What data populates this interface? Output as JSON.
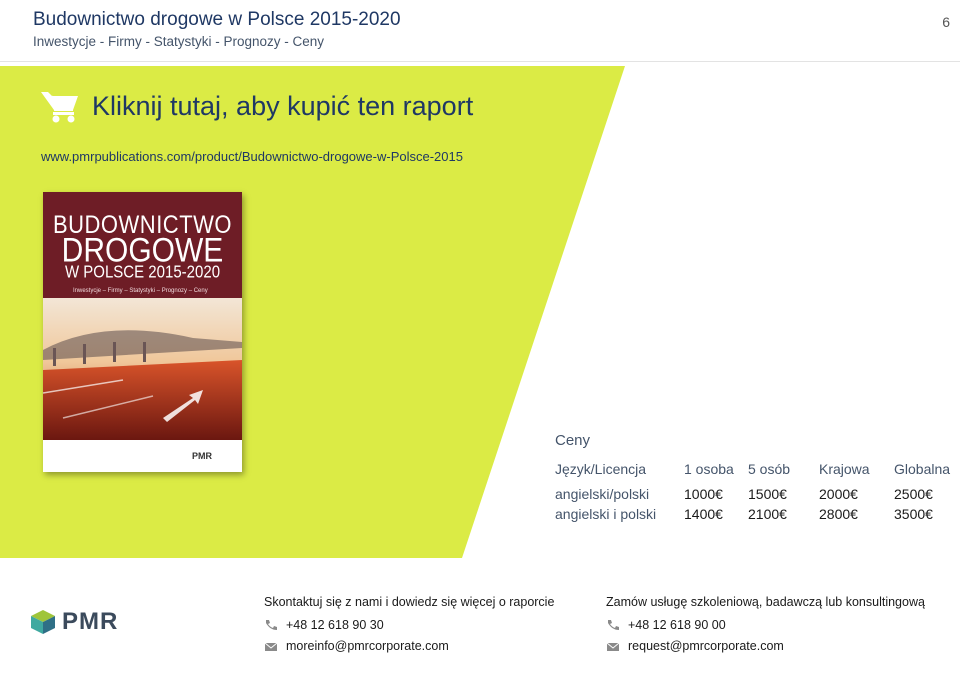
{
  "header": {
    "title": "Budownictwo drogowe w Polsce 2015-2020",
    "subtitle": "Inwestycje - Firmy - Statystyki - Prognozy - Ceny",
    "page_number": "6"
  },
  "promo": {
    "buy_label": "Kliknij tutaj, aby kupić ten raport",
    "url": "www.pmrpublications.com/product/Budownictwo-drogowe-w-Polsce-2015",
    "accent_color": "#dbeb45",
    "icon": "shopping-cart-icon"
  },
  "cover": {
    "line1": "BUDOWNICTWO",
    "line2": "DROGOWE",
    "line3": "W POLSCE 2015-2020",
    "line4": "Inwestycje – Firmy – Statystyki – Prognozy – Ceny",
    "logo": "PMR"
  },
  "prices": {
    "title": "Ceny",
    "headers": [
      "Język/Licencja",
      "1 osoba",
      "5 osób",
      "Krajowa",
      "Globalna"
    ],
    "rows": [
      {
        "lang": "angielski/polski",
        "p1": "1000€",
        "p5": "1500€",
        "national": "2000€",
        "global": "2500€"
      },
      {
        "lang": "angielski i polski",
        "p1": "1400€",
        "p5": "2100€",
        "national": "2800€",
        "global": "3500€"
      }
    ]
  },
  "footer": {
    "logo_text": "PMR",
    "left": {
      "heading": "Skontaktuj się z nami i dowiedz się więcej o raporcie",
      "phone": "+48 12 618 90 30",
      "email": "moreinfo@pmrcorporate.com"
    },
    "right": {
      "heading": "Zamów usługę szkoleniową, badawczą lub konsultingową",
      "phone": "+48 12 618 90 00",
      "email": "request@pmrcorporate.com"
    }
  }
}
